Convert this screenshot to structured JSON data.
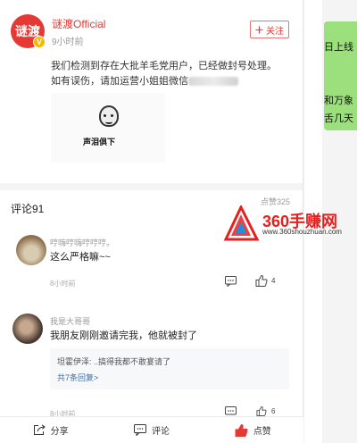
{
  "post": {
    "author": "谜渡Official",
    "avatar_text": "谜渡",
    "badge": "V",
    "time": "9小时前",
    "follow_label": "关注",
    "text_line1": "我们检测到存在大批羊毛党用户，已经做封号处理。",
    "text_line2": "如有误伤，请加运营小姐姐微信",
    "meme_caption": "声泪俱下"
  },
  "comments_section": {
    "title": "评论91",
    "likes_label": "点赞325"
  },
  "comments": [
    {
      "name": "哼嗨哼嗨哼哼哼。",
      "text": "这么严格嘛~~",
      "time": "8小时前",
      "like_count": "4"
    },
    {
      "name": "我是大哥哥",
      "text": "我朋友刚刚邀请完我，他就被封了",
      "time": "8小时前",
      "like_count": "6",
      "reply_preview": "坦霍伊泽: ..搞得我都不敢宴请了",
      "reply_more": "共7条回复>"
    }
  ],
  "bottom_bar": {
    "share": "分享",
    "comment": "评论",
    "like": "点赞"
  },
  "right_panel": {
    "line1": "日上线",
    "line2": "和万象",
    "line3": "舌几天"
  },
  "watermark": {
    "brand": "360手赚网",
    "url": "www.360shouzhuan.com"
  },
  "colors": {
    "accent": "#e53935",
    "link": "#3b6ea5",
    "green_card": "#9be07c"
  }
}
